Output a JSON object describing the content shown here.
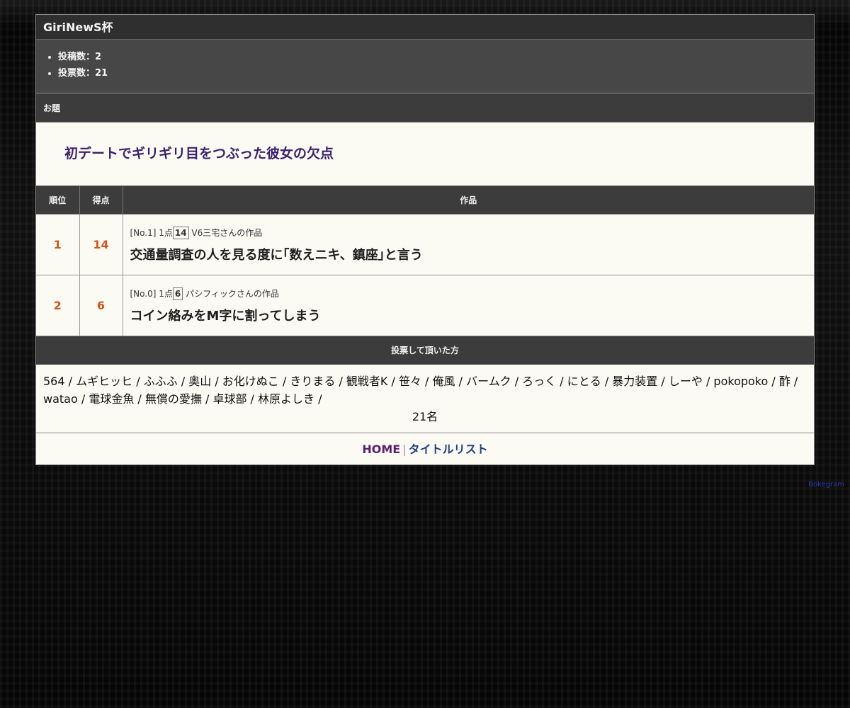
{
  "page": {
    "title": "GiriNewS杯"
  },
  "stats": {
    "posts": "投稿数：2",
    "votes": "投票数：21"
  },
  "theme": {
    "header": "お題",
    "text": "初デートでギリギリ目をつぶった彼女の欠点"
  },
  "results_table": {
    "headers": [
      "順位",
      "得点",
      "作品"
    ],
    "rows": [
      {
        "rank": "1",
        "score": "14",
        "meta_prefix": "[No.1] 1点",
        "meta_points": "14",
        "meta_author": "V6三宅さんの作品",
        "text": "交通量調査の人を見る度に｢数えニキ、鎮座｣と言う"
      },
      {
        "rank": "2",
        "score": "6",
        "meta_prefix": "[No.0] 1点",
        "meta_points": "6",
        "meta_author": "パシフィックさんの作品",
        "text": "コイン絡みをM字に割ってしまう"
      }
    ]
  },
  "voters": {
    "header": "投票して頂いた方",
    "list": "564 / ムギヒッヒ / ふふふ / 奥山 / お化けぬこ / きりまる / 観戦者K / 笹々 / 俺風 / バームク / ろっく / にとる / 暴力装置 / しーや / pokopoko / 酢 / watao / 電球金魚 / 無償の愛撫 / 卓球部 / 林原よしき /",
    "count": "21名"
  },
  "footer": {
    "home": "HOME",
    "separator": "|",
    "title_list": "タイトルリスト"
  },
  "credit": "Bokegram",
  "colors": {
    "rank_score": "#d4551a",
    "theme_text": "#3a1f6e",
    "home_link": "#5b1f74",
    "title_list_link": "#1f3f8f",
    "credit_link": "#2a3ea8"
  }
}
